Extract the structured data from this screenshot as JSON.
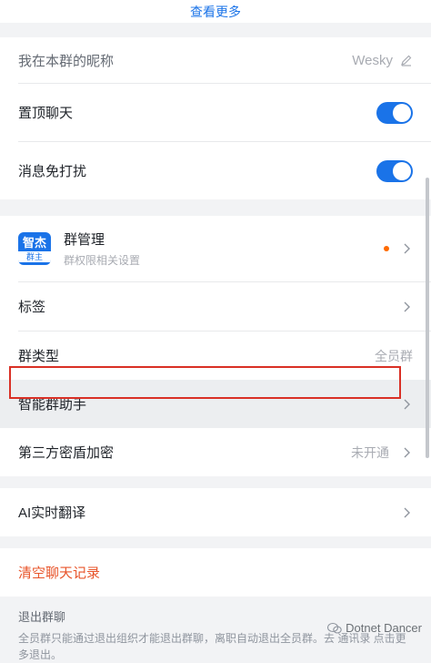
{
  "top": {
    "more_label": "查看更多"
  },
  "settings": {
    "nickname_label": "我在本群的昵称",
    "nickname_value": "Wesky",
    "pin_label": "置顶聊天",
    "mute_label": "消息免打扰"
  },
  "group_manage": {
    "avatar_line1": "智杰",
    "avatar_line2": "群主",
    "title": "群管理",
    "subtitle": "群权限相关设置"
  },
  "group_info": {
    "tags_label": "标签",
    "type_label": "群类型",
    "type_value": "全员群",
    "assistant_label": "智能群助手",
    "encryption_label": "第三方密盾加密",
    "encryption_value": "未开通"
  },
  "translate": {
    "label": "AI实时翻译"
  },
  "clear": {
    "label": "清空聊天记录"
  },
  "exit": {
    "title": "退出群聊",
    "desc": "全员群只能通过退出组织才能退出群聊，离职自动退出全员群。去 通讯录 点击更多退出。"
  },
  "watermark": {
    "text": "Dotnet Dancer"
  },
  "colors": {
    "accent": "#1a73e8",
    "danger": "#e8542a",
    "highlight_border": "#d93025"
  }
}
